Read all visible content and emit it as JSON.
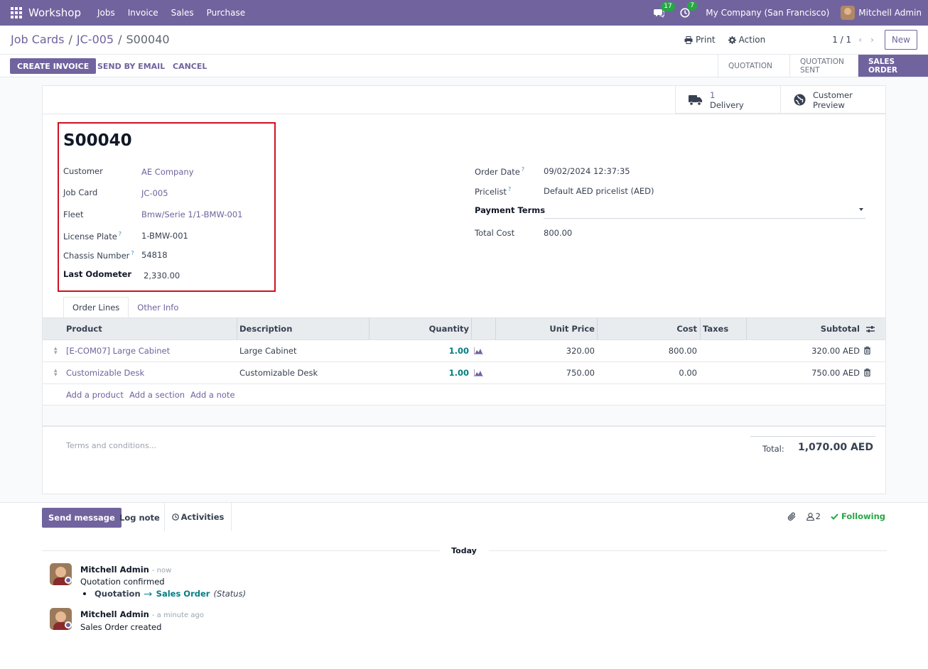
{
  "navbar": {
    "brand": "Workshop",
    "menu": [
      "Jobs",
      "Invoice",
      "Sales",
      "Purchase"
    ],
    "messages_count": "17",
    "activities_count": "7",
    "company": "My Company (San Francisco)",
    "user": "Mitchell Admin"
  },
  "control": {
    "breadcrumb": [
      "Job Cards",
      "/",
      "JC-005",
      "/",
      "S00040"
    ],
    "print_label": "Print",
    "action_label": "Action",
    "pager": "1 / 1",
    "new_label": "New"
  },
  "statusbar": {
    "create_invoice": "CREATE INVOICE",
    "send_by_email": "SEND BY EMAIL",
    "cancel": "CANCEL",
    "stages": [
      "QUOTATION",
      "QUOTATION SENT",
      "SALES ORDER"
    ],
    "active_stage": "SALES ORDER"
  },
  "smart_buttons": {
    "delivery_count": "1",
    "delivery_label": "Delivery",
    "preview_line1": "Customer",
    "preview_line2": "Preview"
  },
  "record": {
    "name": "S00040",
    "left_fields": [
      {
        "label": "Customer",
        "value": "AE Company"
      },
      {
        "label": "Job Card",
        "value": "JC-005"
      },
      {
        "label": "Fleet",
        "value": "Bmw/Serie 1/1-BMW-001"
      },
      {
        "label": "License Plate",
        "value": "1-BMW-001"
      },
      {
        "label": "Chassis Number",
        "value": "54818"
      },
      {
        "label": "Last Odometer",
        "value": "2,330.00"
      }
    ],
    "right_fields": [
      {
        "label": "Order Date",
        "value": "09/02/2024 12:37:35"
      },
      {
        "label": "Pricelist",
        "value": "Default AED pricelist (AED)"
      },
      {
        "label": "Payment Terms",
        "value": ""
      },
      {
        "label": "Total Cost",
        "value": "800.00"
      }
    ]
  },
  "tabs": [
    "Order Lines",
    "Other Info"
  ],
  "lines": {
    "headers": [
      "Product",
      "Description",
      "Quantity",
      "Unit Price",
      "Cost",
      "Taxes",
      "Subtotal"
    ],
    "rows": [
      {
        "product": "[E-COM07] Large Cabinet",
        "description": "Large Cabinet",
        "quantity": "1.00",
        "unit_price": "320.00",
        "cost": "800.00",
        "taxes": "",
        "subtotal": "320.00 AED"
      },
      {
        "product": "Customizable Desk",
        "description": "Customizable Desk",
        "quantity": "1.00",
        "unit_price": "750.00",
        "cost": "0.00",
        "taxes": "",
        "subtotal": "750.00 AED"
      }
    ],
    "add_product": "Add a product",
    "add_section": "Add a section",
    "add_note": "Add a note"
  },
  "footer": {
    "terms_placeholder": "Terms and conditions...",
    "total_label": "Total:",
    "total_value": "1,070.00 AED"
  },
  "chatter": {
    "send_message": "Send message",
    "log_note": "Log note",
    "activities": "Activities",
    "followers_count": "2",
    "following": "Following",
    "today": "Today",
    "messages": [
      {
        "author": "Mitchell Admin",
        "time": "- now",
        "body": "Quotation confirmed",
        "tracking_old": "Quotation",
        "tracking_new": "Sales Order",
        "tracking_field": "(Status)"
      },
      {
        "author": "Mitchell Admin",
        "time": "- a minute ago",
        "body": "Sales Order created"
      }
    ]
  },
  "colors": {
    "brand": "#71639e",
    "highlight_box": "#d0101f",
    "success": "#28a745",
    "teal": "#017e84"
  }
}
